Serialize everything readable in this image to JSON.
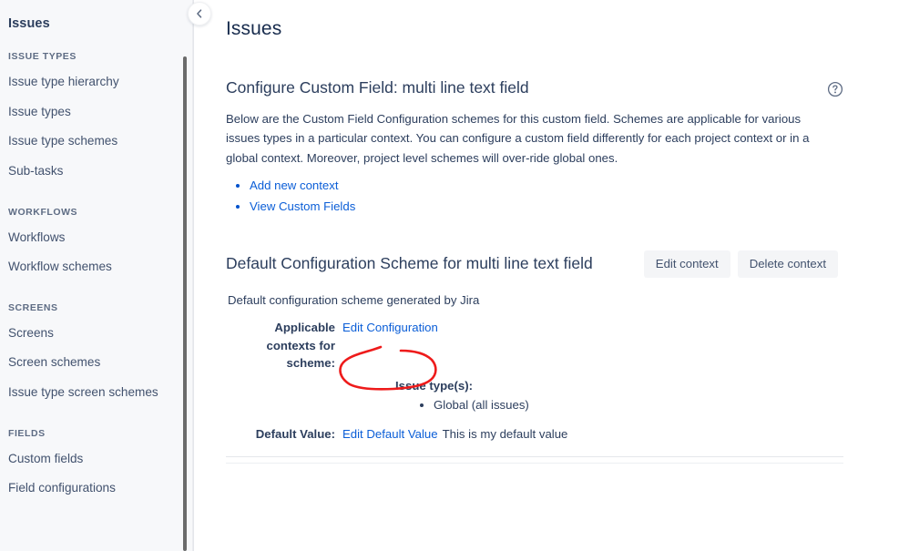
{
  "sidebar": {
    "title": "Issues",
    "collapse_icon": "chevron-left-icon",
    "sections": [
      {
        "header": "ISSUE TYPES",
        "items": [
          {
            "label": "Issue type hierarchy"
          },
          {
            "label": "Issue types"
          },
          {
            "label": "Issue type schemes"
          },
          {
            "label": "Sub-tasks"
          }
        ]
      },
      {
        "header": "WORKFLOWS",
        "items": [
          {
            "label": "Workflows"
          },
          {
            "label": "Workflow schemes"
          }
        ]
      },
      {
        "header": "SCREENS",
        "items": [
          {
            "label": "Screens"
          },
          {
            "label": "Screen schemes"
          },
          {
            "label": "Issue type screen schemes"
          }
        ]
      },
      {
        "header": "FIELDS",
        "items": [
          {
            "label": "Custom fields"
          },
          {
            "label": "Field configurations"
          }
        ]
      }
    ]
  },
  "main": {
    "page_title": "Issues",
    "config_section": {
      "title": "Configure Custom Field: multi line text field",
      "help_icon": "help-circle-icon",
      "description": "Below are the Custom Field Configuration schemes for this custom field. Schemes are applicable for various issues types in a particular context. You can configure a custom field differently for each project context or in a global context. Moreover, project level schemes will over-ride global ones.",
      "links": [
        {
          "label": "Add new context"
        },
        {
          "label": "View Custom Fields"
        }
      ]
    },
    "scheme_section": {
      "title": "Default Configuration Scheme for multi line text field",
      "edit_context_label": "Edit context",
      "delete_context_label": "Delete context",
      "description": "Default configuration scheme generated by Jira",
      "applicable_label": "Applicable contexts for scheme:",
      "edit_configuration_link": "Edit Configuration",
      "issue_types_label": "Issue type(s):",
      "issue_types": [
        {
          "label": "Global (all issues)"
        }
      ],
      "default_value_label": "Default Value:",
      "edit_default_value_link": "Edit Default Value",
      "default_value_text": "This is my default value"
    }
  },
  "annotation": {
    "shape": "red-ellipse-highlight",
    "target": "Edit Default Value",
    "color": "#EE1B1B"
  },
  "colors": {
    "link": "#0B5ED7",
    "text": "#2C3E5D",
    "title": "#172B4D",
    "sidebar_bg": "#F7F8FA",
    "button_bg": "#F4F5F7",
    "annotation_red": "#EE1B1B"
  }
}
